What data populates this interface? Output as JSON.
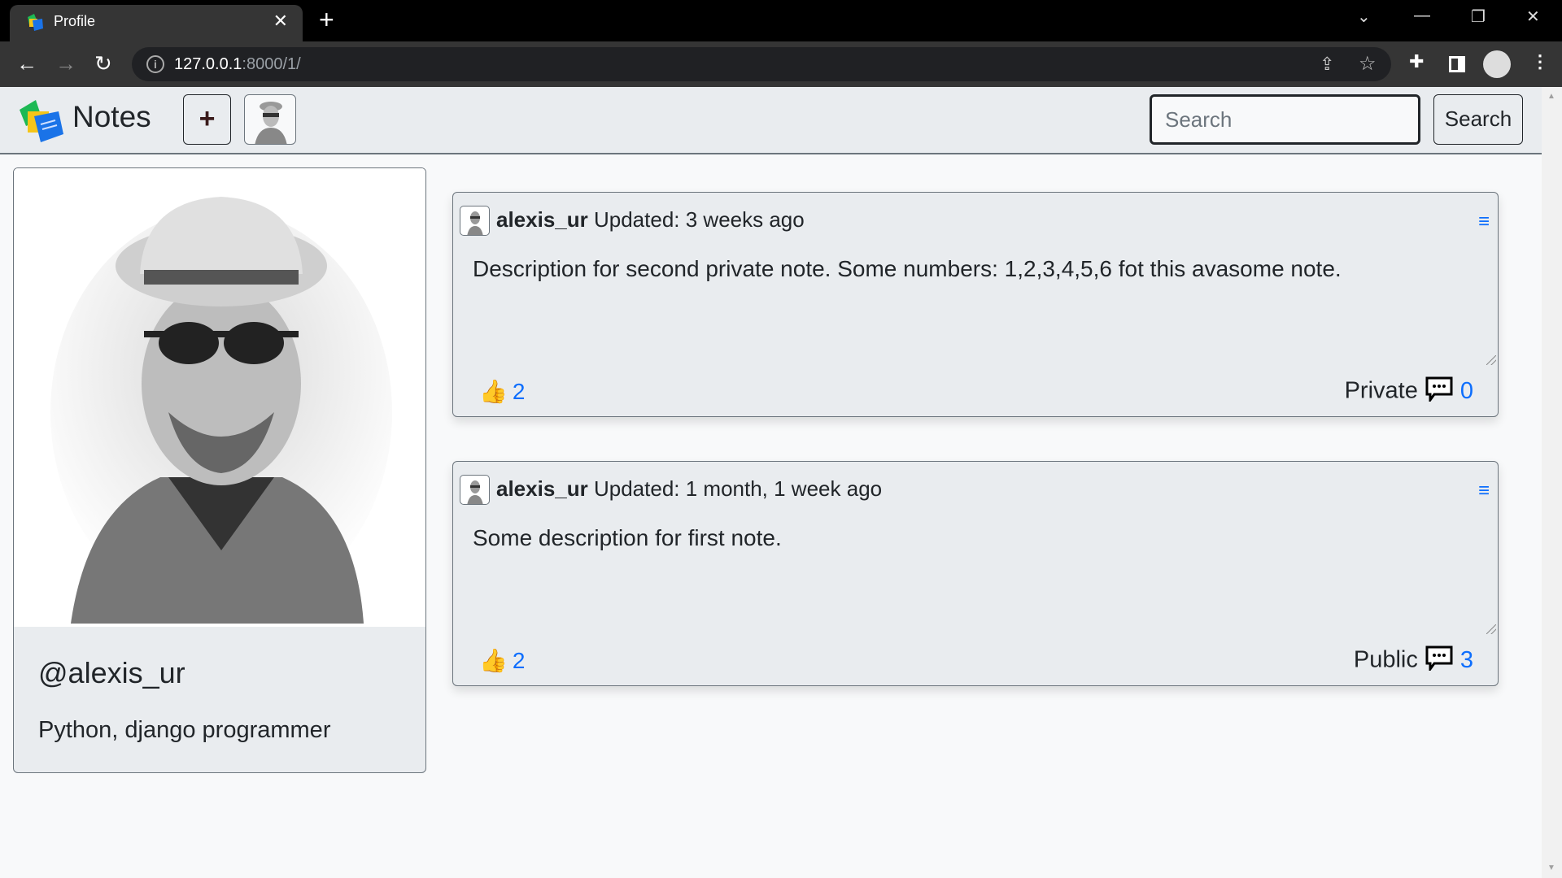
{
  "browser": {
    "tab_title": "Profile",
    "url_host": "127.0.0.1",
    "url_rest": ":8000/1/"
  },
  "header": {
    "brand": "Notes",
    "add_label": "+",
    "search_placeholder": "Search",
    "search_button": "Search"
  },
  "profile": {
    "handle": "@alexis_ur",
    "bio": "Python, django programmer"
  },
  "notes": [
    {
      "author": "alexis_ur",
      "updated": "Updated: 3 weeks ago",
      "description": "Description for second private note. Some numbers: 1,2,3,4,5,6 fot this avasome note.",
      "likes": "2",
      "visibility": "Private",
      "comments": "0"
    },
    {
      "author": "alexis_ur",
      "updated": "Updated: 1 month, 1 week ago",
      "description": "Some description for first note.",
      "likes": "2",
      "visibility": "Public",
      "comments": "3"
    }
  ],
  "colors": {
    "accent": "#0d6efd",
    "header_bg": "#e9ecef",
    "page_bg": "#f8f9fa",
    "border": "#6c757d"
  }
}
